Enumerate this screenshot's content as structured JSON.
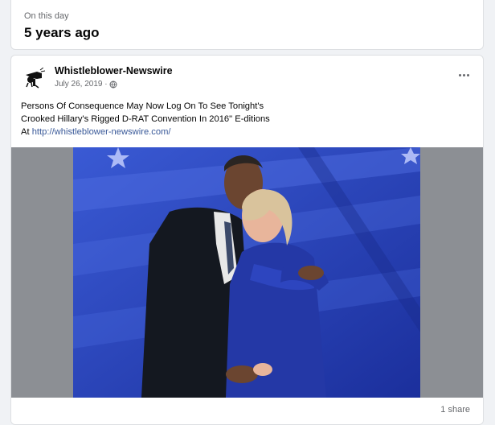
{
  "memory": {
    "label": "On this day",
    "title": "5 years ago"
  },
  "post": {
    "page_name": "Whistleblower-Newswire",
    "date": "July 26, 2019 ·",
    "audience_icon": "globe-icon",
    "more_icon": "more-options-icon",
    "text_line1": "Persons Of Consequence May Now Log On To See Tonight's",
    "text_line2": "Crooked Hillary's Rigged D-RAT Convention In 2016\" E-ditions",
    "text_at": "At ",
    "link": "http://whistleblower-newswire.com/",
    "share_count": "1 share"
  },
  "colors": {
    "page_bg": "#f0f2f5",
    "link": "#385898",
    "photo_backdrop": "#2a44b8",
    "media_bg": "#8c8f94"
  }
}
